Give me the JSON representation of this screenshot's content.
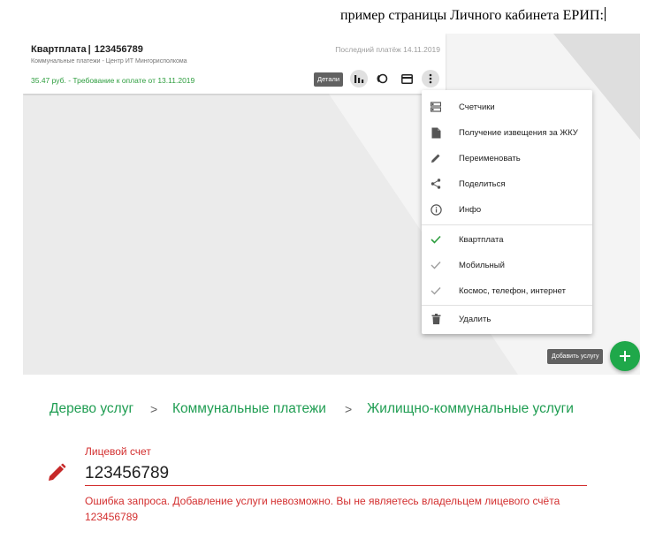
{
  "caption": "пример страницы Личного кабинета ЕРИП:",
  "card": {
    "title": "Квартплата",
    "separator": "|",
    "account": "123456789",
    "subtitle": "Коммунальные платежи - Центр ИТ Мингорисполкома",
    "last_payment": "Последний платёж 14.11.2019",
    "amount_due": "35.47 руб. - Требование к оплате от 13.11.2019",
    "details_label": "Детали",
    "icons": [
      "bar-chart-icon",
      "toggle-icon",
      "credit-card-icon",
      "more-vert-icon"
    ]
  },
  "menu": {
    "items": [
      {
        "label": "Счетчики",
        "icon": "meter-list-icon"
      },
      {
        "label": "Получение извещения за ЖКУ",
        "icon": "document-icon"
      },
      {
        "label": "Переименовать",
        "icon": "pencil-icon"
      },
      {
        "label": "Поделиться",
        "icon": "share-icon"
      },
      {
        "label": "Инфо",
        "icon": "info-icon"
      },
      {
        "label": "Квартплата",
        "icon": "check-icon",
        "checked": true
      },
      {
        "label": "Мобильный",
        "icon": "check-icon",
        "checked": false
      },
      {
        "label": "Космос, телефон, интернет",
        "icon": "check-icon",
        "checked": false
      },
      {
        "label": "Удалить",
        "icon": "trash-icon"
      }
    ]
  },
  "add_service": {
    "tooltip": "Добавить услугу",
    "fab_icon": "plus-icon"
  },
  "breadcrumb": {
    "items": [
      "Дерево услуг",
      "Коммунальные платежи",
      "Жилищно-коммунальные услуги"
    ],
    "separator": ">"
  },
  "account_form": {
    "label": "Лицевой счет",
    "value": "123456789",
    "error": "Ошибка запроса. Добавление услуги невозможно. Вы не являетесь владельцем лицевого счёта  123456789"
  },
  "colors": {
    "accent_green": "#1fa84a",
    "link_green": "#1f9d52",
    "error_red": "#d32f2f",
    "amount_green": "#2e9e3f"
  }
}
